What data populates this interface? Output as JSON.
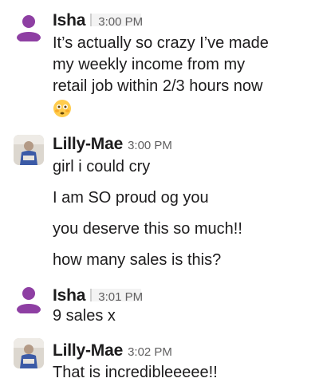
{
  "messages": [
    {
      "sender": "Isha",
      "time": "3:00 PM",
      "avatar": "default-user-avatar",
      "lines": [
        "It’s actually so crazy I’ve made",
        "my weekly income from my",
        "retail job within 2/3 hours now"
      ],
      "emoji": "flushed-face-icon"
    },
    {
      "sender": "Lilly-Mae",
      "time": "3:00 PM",
      "avatar": "photo-avatar",
      "lines": [
        "girl i could cry",
        "I am SO proud og you",
        "you deserve this so much!!",
        "how many sales is this?"
      ]
    },
    {
      "sender": "Isha",
      "time": "3:01 PM",
      "avatar": "default-user-avatar",
      "lines": [
        "9 sales x"
      ]
    },
    {
      "sender": "Lilly-Mae",
      "time": "3:02 PM",
      "avatar": "photo-avatar",
      "lines": [
        "That is incredibleeeee!!"
      ]
    }
  ],
  "colors": {
    "default_avatar": "#8e3fa3",
    "text": "#1d1c1d",
    "timestamp": "#616061"
  }
}
